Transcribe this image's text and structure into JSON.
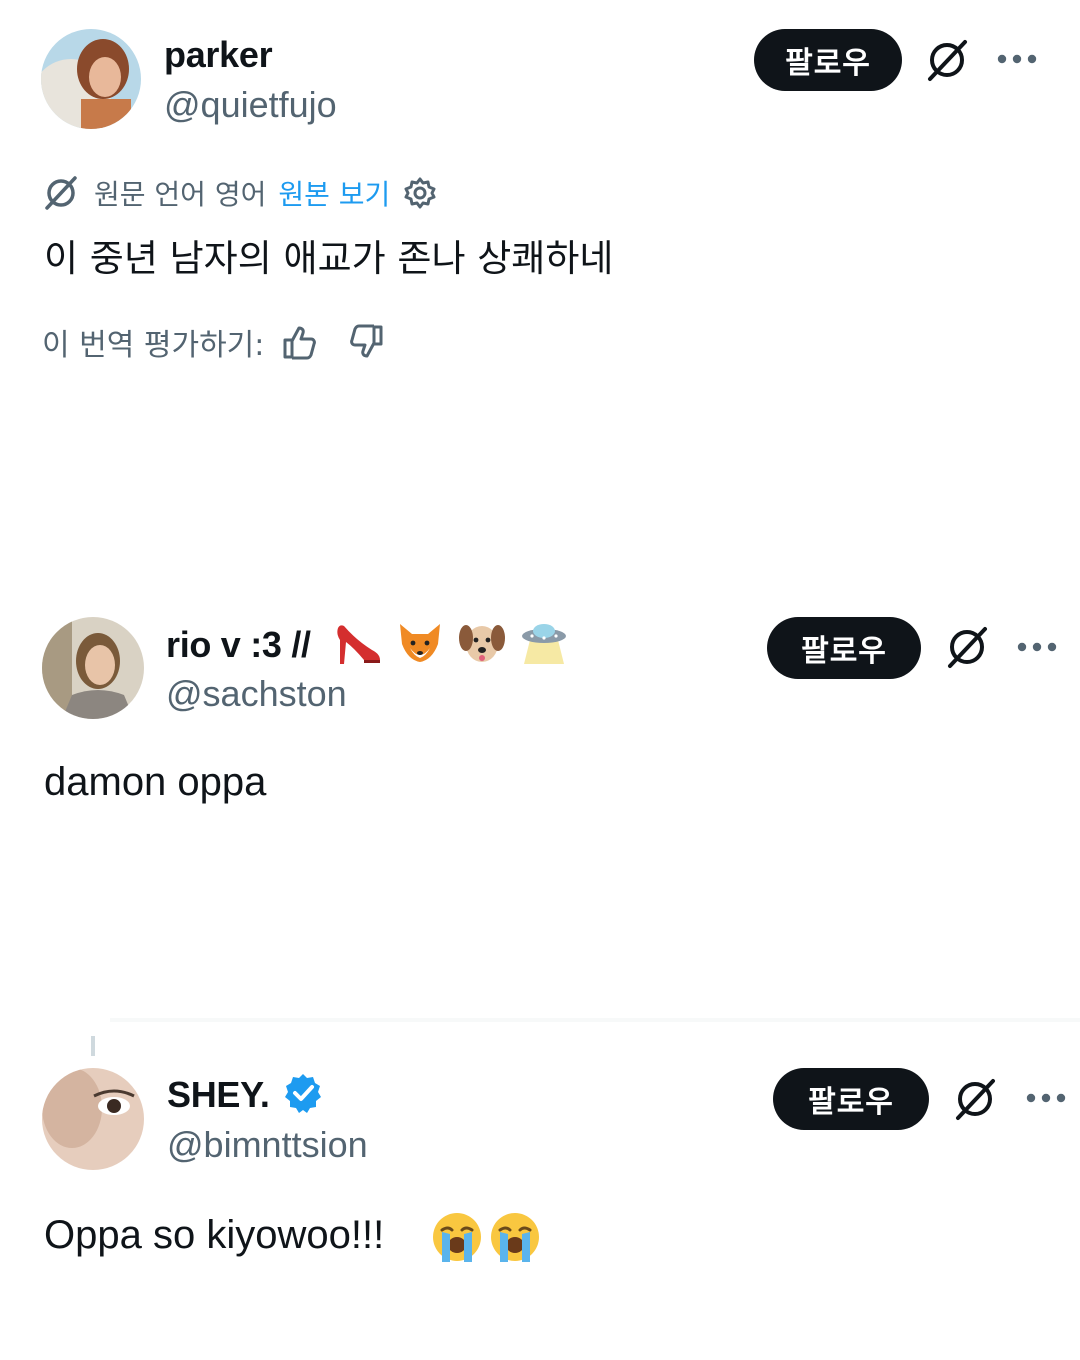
{
  "follow_label": "팔로우",
  "colors": {
    "follow_bg": "#0f1419",
    "link": "#1d9bf0",
    "verified": "#1d9bf0",
    "secondary_text": "#536471"
  },
  "posts": [
    {
      "display_name": "parker",
      "handle": "@quietfujo",
      "translation": {
        "source_label": "원문 언어 영어",
        "view_original": "원본 보기",
        "icons": [
          "grok-icon",
          "gear-icon"
        ]
      },
      "text": "이 중년 남자의 애교가 존나 상쾌하네",
      "rate_label": "이 번역 평가하기:",
      "rate_icons": [
        "thumbs-up-icon",
        "thumbs-down-icon"
      ]
    },
    {
      "display_name": "rio v :3 //",
      "name_emojis": [
        "high-heel",
        "fox",
        "dog",
        "ufo"
      ],
      "handle": "@sachston",
      "text": "damon oppa"
    },
    {
      "display_name": "SHEY.",
      "verified": true,
      "handle": "@bimnttsion",
      "text": "Oppa so kiyowoo!!!",
      "text_emojis": [
        "loudly-crying-face",
        "loudly-crying-face"
      ]
    }
  ]
}
